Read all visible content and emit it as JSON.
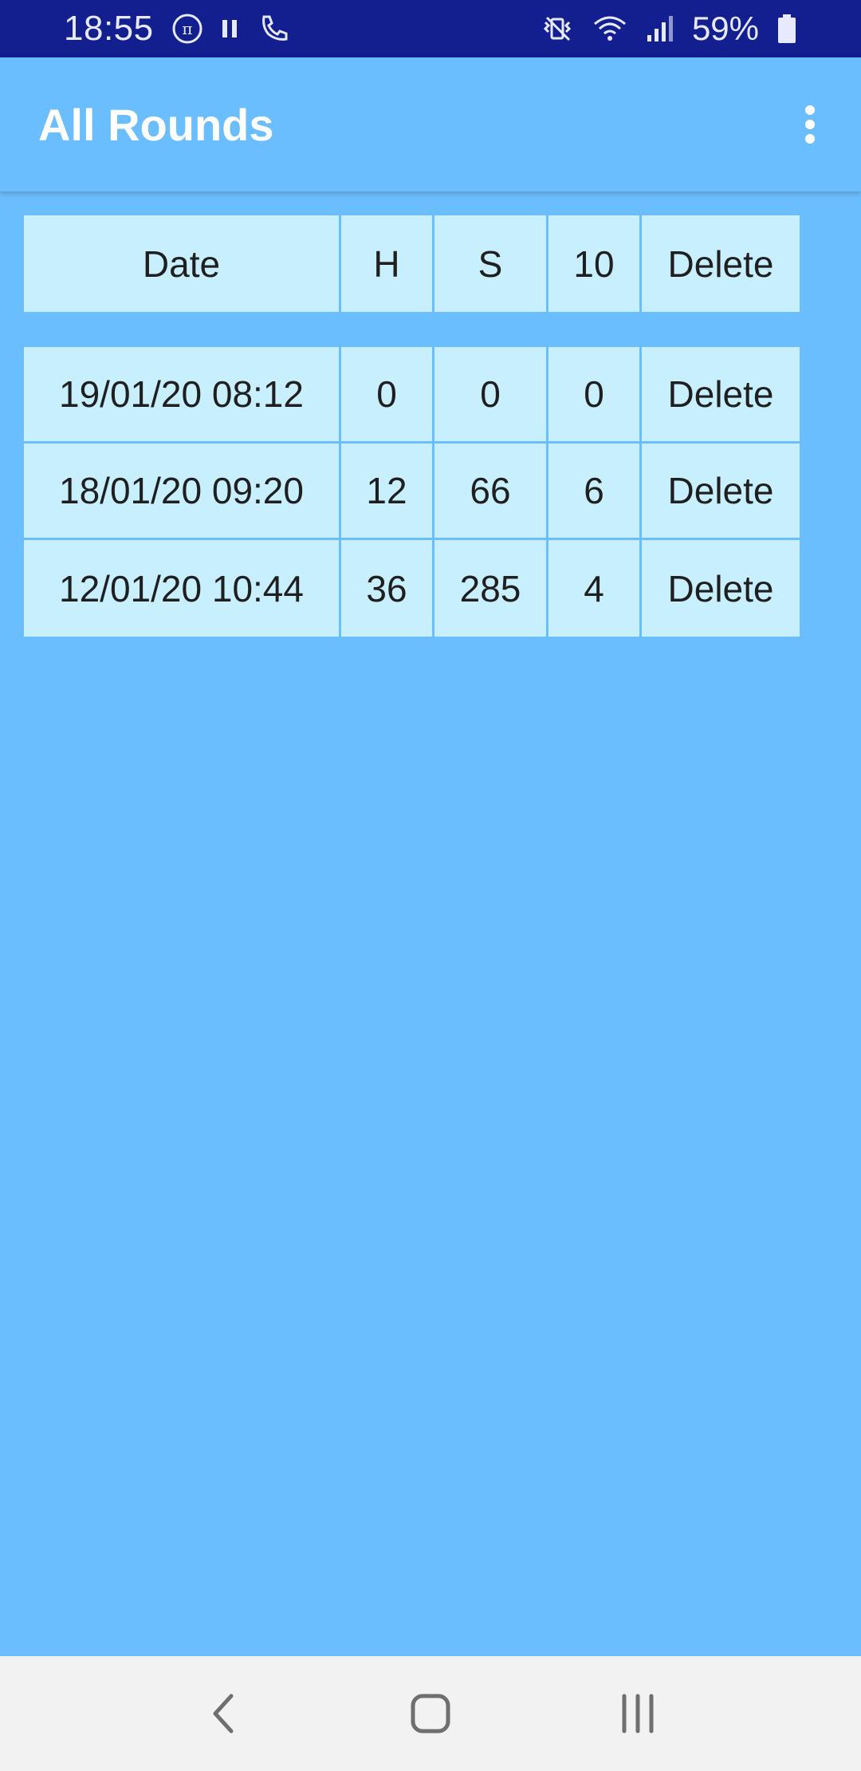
{
  "status_bar": {
    "time": "18:55",
    "battery_percent": "59%",
    "icons_left": [
      "pi-icon",
      "pause-icon",
      "phone-call-icon"
    ],
    "icons_right": [
      "vibrate-mute-icon",
      "wifi-icon",
      "signal-icon",
      "battery-icon"
    ]
  },
  "app_bar": {
    "title": "All Rounds",
    "menu_icon": "more-vert-icon"
  },
  "table": {
    "headers": [
      "Date",
      "H",
      "S",
      "10",
      "Delete"
    ],
    "rows": [
      {
        "date": "19/01/20 08:12",
        "h": "0",
        "s": "0",
        "ten": "0",
        "delete": "Delete"
      },
      {
        "date": "18/01/20 09:20",
        "h": "12",
        "s": "66",
        "ten": "6",
        "delete": "Delete"
      },
      {
        "date": "12/01/20 10:44",
        "h": "36",
        "s": "285",
        "ten": "4",
        "delete": "Delete"
      }
    ]
  },
  "nav_bar": {
    "icons": [
      "back-icon",
      "home-icon",
      "recents-icon"
    ]
  },
  "colors": {
    "status_bar": "#131f8f",
    "background": "#6bbefd",
    "cell": "#c8effe",
    "nav_bar": "#f2f2f2"
  }
}
